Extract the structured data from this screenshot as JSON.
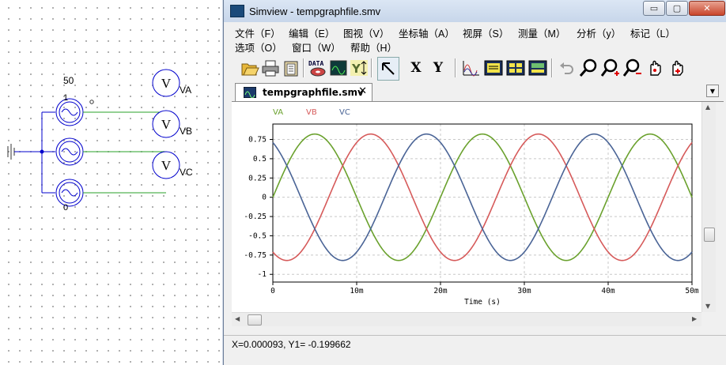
{
  "schematic": {
    "source_value": "50",
    "node_top": "1",
    "node_bottom": "0",
    "meters": [
      {
        "symbol": "V",
        "label": "VA"
      },
      {
        "symbol": "V",
        "label": "VB"
      },
      {
        "symbol": "V",
        "label": "VC"
      }
    ]
  },
  "window": {
    "title": "Simview - tempgraphfile.smv",
    "controls": {
      "minimize": "▭",
      "maximize": "▢",
      "close": "✕"
    }
  },
  "menu": [
    "文件（F）",
    "编辑（E）",
    "图视（V）",
    "坐标轴（A）",
    "视屏（S）",
    "测量（M）",
    "分析（y）",
    "标记（L）",
    "选项（O）",
    "窗口（W）",
    "帮助（H）"
  ],
  "toolbar": [
    {
      "name": "open-icon"
    },
    {
      "name": "print-icon"
    },
    {
      "name": "clipboard-icon"
    },
    {
      "name": "data-icon",
      "text": "DATA"
    },
    {
      "name": "add-curve-icon"
    },
    {
      "name": "y-axis-icon",
      "text": "Y"
    },
    {
      "name": "select-arrow-icon"
    },
    {
      "name": "x-button",
      "text": "X"
    },
    {
      "name": "y-button",
      "text": "Y"
    },
    {
      "name": "waveform-icon"
    },
    {
      "name": "screen1-icon"
    },
    {
      "name": "screen4-icon"
    },
    {
      "name": "screen-icon"
    },
    {
      "name": "undo-icon"
    },
    {
      "name": "zoom-icon"
    },
    {
      "name": "zoom-in-icon"
    },
    {
      "name": "zoom-out-icon"
    },
    {
      "name": "pan-icon"
    },
    {
      "name": "hand-plus-icon"
    }
  ],
  "tab": {
    "title": "tempgraphfile.smv",
    "close": "✕",
    "menu_arrow": "▼"
  },
  "chart_data": {
    "type": "line",
    "xlabel": "Time (s)",
    "ylabel": "",
    "xlim": [
      0,
      0.05
    ],
    "ylim": [
      -1.1,
      0.95
    ],
    "x_ticks": [
      "0",
      "10m",
      "20m",
      "30m",
      "40m",
      "50m"
    ],
    "y_ticks": [
      "0.75",
      "0.5",
      "0.25",
      "0",
      "-0.25",
      "-0.5",
      "-0.75",
      "-1"
    ],
    "y_tick_values": [
      0.75,
      0.5,
      0.25,
      0,
      -0.25,
      -0.5,
      -0.75,
      -1
    ],
    "grid": true,
    "frequency_hz": 50,
    "amplitude": 0.82,
    "series": [
      {
        "name": "VA",
        "color": "#6aa12d",
        "phase_deg": 0
      },
      {
        "name": "VB",
        "color": "#d65a5a",
        "phase_deg": -120
      },
      {
        "name": "VC",
        "color": "#4a6496",
        "phase_deg": 120
      }
    ],
    "legend": "top-left"
  },
  "status": {
    "text": "X=0.000093, Y1= -0.199662"
  }
}
